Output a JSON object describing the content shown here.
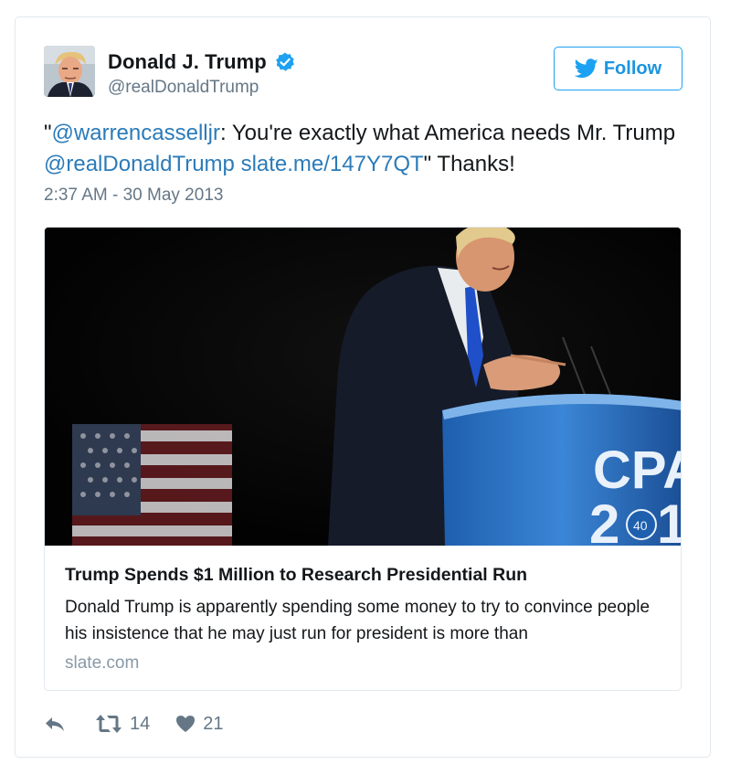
{
  "author": {
    "name": "Donald J. Trump",
    "handle": "@realDonaldTrump",
    "verified": true
  },
  "follow_button": {
    "label": "Follow"
  },
  "tweet": {
    "text_open_quote": "\"",
    "mention_1": "@warrencasselljr",
    "text_1": ": You're exactly what America needs Mr. Trump ",
    "mention_2": "@realDonaldTrump",
    "link": "slate.me/147Y7QT",
    "text_2": "\" Thanks!",
    "timestamp": "2:37 AM - 30 May 2013"
  },
  "card": {
    "podium_text": "CPA",
    "podium_sub_1": "2",
    "podium_sub_2": "1",
    "podium_badge": "40",
    "title": "Trump Spends $1 Million to Research Presidential Run",
    "description": "Donald Trump is apparently spending some money to try to convince people his insistence that he may just run for president is more than",
    "domain": "slate.com"
  },
  "actions": {
    "retweet_count": "14",
    "like_count": "21"
  },
  "colors": {
    "link": "#2b7bb9",
    "twitter_blue": "#1da1f2",
    "muted": "#657786"
  }
}
